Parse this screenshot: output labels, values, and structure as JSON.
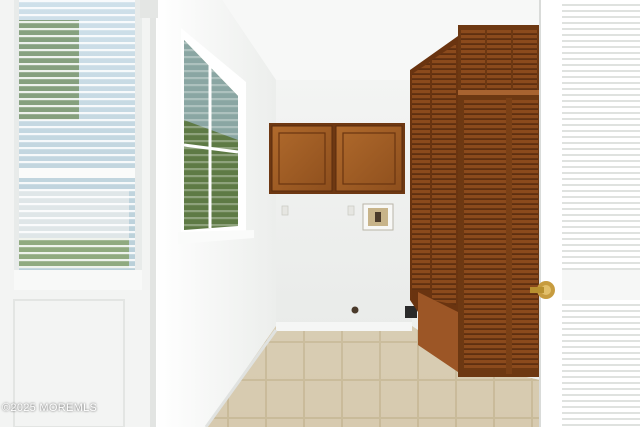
{
  "photo": {
    "watermark_text": "©2025 MOREMLS",
    "colors": {
      "wall": "#f1f2f1",
      "ceiling": "#f6f7f6",
      "wood": "#8a4a1e",
      "wood_light": "#a8622a",
      "floor_tile": "#d9cdb3",
      "door_white": "#f4f5f4",
      "brass": "#c9a24a"
    }
  }
}
